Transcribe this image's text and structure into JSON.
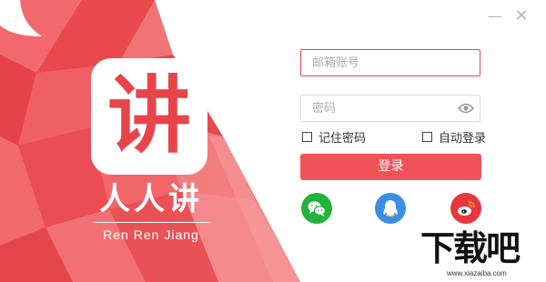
{
  "window": {
    "minimize_glyph": "—",
    "close_glyph": "✕"
  },
  "brand": {
    "logo_char": "讲",
    "app_name": "人人讲",
    "pinyin": "Ren Ren Jiang",
    "accent": "#e8454b"
  },
  "form": {
    "email_placeholder": "邮箱账号",
    "password_placeholder": "密码",
    "remember_label": "记住密码",
    "remember_checked": false,
    "autologin_label": "自动登录",
    "autologin_checked": false,
    "login_label": "登录",
    "button_color": "#ef5359"
  },
  "social": {
    "icons": [
      "wechat-icon",
      "qq-icon",
      "weibo-icon"
    ],
    "colors": [
      "#22b33a",
      "#3a8ee6",
      "#e8363d"
    ]
  },
  "watermark": {
    "big": "下载吧",
    "small": "www.xiazaiba.com"
  }
}
